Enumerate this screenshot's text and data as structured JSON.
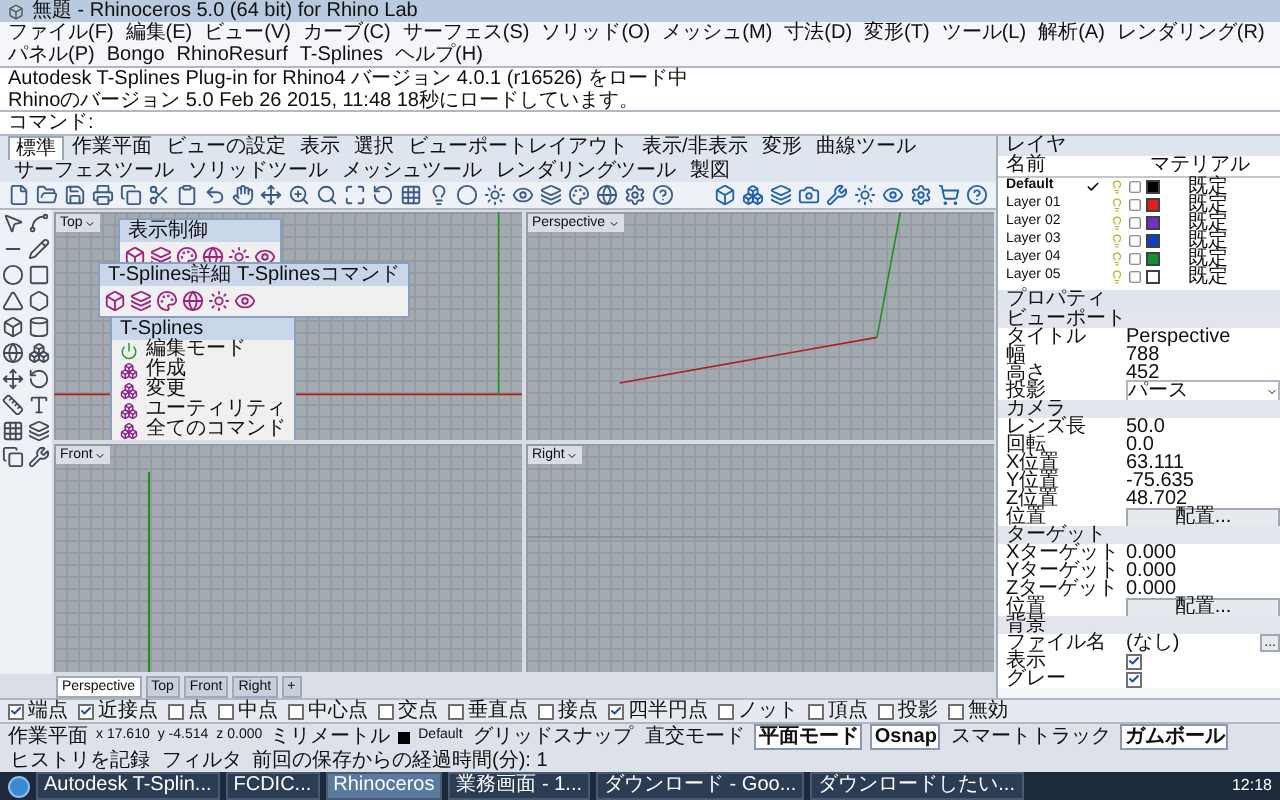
{
  "window": {
    "title": "無題 - Rhinoceros 5.0 (64 bit) for Rhino Lab"
  },
  "menu": [
    "ファイル(F)",
    "編集(E)",
    "ビュー(V)",
    "カーブ(C)",
    "サーフェス(S)",
    "ソリッド(O)",
    "メッシュ(M)",
    "寸法(D)",
    "変形(T)",
    "ツール(L)",
    "解析(A)",
    "レンダリング(R)",
    "パネル(P)",
    "Bongo",
    "RhinoResurf",
    "T-Splines",
    "ヘルプ(H)"
  ],
  "history": [
    "Autodesk T-Splines Plug-in for Rhino4 バージョン 4.0.1 (r16526) をロード中",
    "Rhinoのバージョン 5.0 Feb 26 2015, 11:48 18秒にロードしています。"
  ],
  "command": {
    "prompt": "コマンド:"
  },
  "toolbar_tabs": [
    {
      "label": "標準",
      "selected": true
    },
    {
      "label": "作業平面",
      "selected": false
    },
    {
      "label": "ビューの設定",
      "selected": false
    },
    {
      "label": "表示",
      "selected": false
    },
    {
      "label": "選択",
      "selected": false
    },
    {
      "label": "ビューポートレイアウト",
      "selected": false
    },
    {
      "label": "表示/非表示",
      "selected": false
    },
    {
      "label": "変形",
      "selected": false
    },
    {
      "label": "曲線ツール",
      "selected": false
    },
    {
      "label": "サーフェスツール",
      "selected": false
    },
    {
      "label": "ソリッドツール",
      "selected": false
    },
    {
      "label": "メッシュツール",
      "selected": false
    },
    {
      "label": "レンダリングツール",
      "selected": false
    },
    {
      "label": "製図",
      "selected": false
    }
  ],
  "viewports": [
    {
      "title": "Top",
      "kind": "top"
    },
    {
      "title": "Perspective",
      "kind": "perspective"
    },
    {
      "title": "Front",
      "kind": "front"
    },
    {
      "title": "Right",
      "kind": "right"
    }
  ],
  "floating_panels": [
    {
      "title": "表示制御",
      "kind": "icons"
    },
    {
      "title": "T-Splines詳細 T-Splinesコマンド",
      "kind": "icons"
    },
    {
      "title": "T-Splines",
      "kind": "menu",
      "items": [
        "編集モード",
        "作成",
        "変更",
        "ユーティリティ",
        "全てのコマンド"
      ]
    }
  ],
  "viewport_tabs": [
    {
      "label": "Perspective",
      "selected": true
    },
    {
      "label": "Top",
      "selected": false
    },
    {
      "label": "Front",
      "selected": false
    },
    {
      "label": "Right",
      "selected": false
    }
  ],
  "add_tab": "+",
  "osnaps": [
    {
      "label": "端点",
      "checked": true
    },
    {
      "label": "近接点",
      "checked": true
    },
    {
      "label": "点",
      "checked": false
    },
    {
      "label": "中点",
      "checked": false
    },
    {
      "label": "中心点",
      "checked": false
    },
    {
      "label": "交点",
      "checked": false
    },
    {
      "label": "垂直点",
      "checked": false
    },
    {
      "label": "接点",
      "checked": false
    },
    {
      "label": "四半円点",
      "checked": true
    },
    {
      "label": "ノット",
      "checked": false
    },
    {
      "label": "頂点",
      "checked": false
    },
    {
      "label": "投影",
      "checked": false
    },
    {
      "label": "無効",
      "checked": false
    }
  ],
  "status_bar": {
    "cplane": "作業平面",
    "x": "x 17.610",
    "y": "y -4.514",
    "z": "z 0.000",
    "units": "ミリメートル",
    "layer": "Default",
    "toggles": [
      {
        "label": "グリッドスナップ",
        "on": false
      },
      {
        "label": "直交モード",
        "on": false
      },
      {
        "label": "平面モード",
        "on": true
      },
      {
        "label": "Osnap",
        "on": true
      },
      {
        "label": "スマートトラック",
        "on": false
      },
      {
        "label": "ガムボール",
        "on": true
      },
      {
        "label": "ヒストリを記録",
        "on": false
      },
      {
        "label": "フィルタ",
        "on": false
      }
    ],
    "message": "前回の保存からの経過時間(分): 1"
  },
  "layers": {
    "title": "レイヤ",
    "columns": [
      "名前",
      "マテリアル"
    ],
    "rows": [
      {
        "name": "Default",
        "current": true,
        "color": "#000000",
        "material": "既定"
      },
      {
        "name": "Layer 01",
        "current": false,
        "color": "#e02020",
        "material": "既定"
      },
      {
        "name": "Layer 02",
        "current": false,
        "color": "#7030c0",
        "material": "既定"
      },
      {
        "name": "Layer 03",
        "current": false,
        "color": "#1040c0",
        "material": "既定"
      },
      {
        "name": "Layer 04",
        "current": false,
        "color": "#109030",
        "material": "既定"
      },
      {
        "name": "Layer 05",
        "current": false,
        "color": "#ffffff",
        "material": "既定"
      }
    ]
  },
  "properties": {
    "title": "プロパティ",
    "sections": [
      {
        "title": "ビューポート",
        "rows": [
          {
            "kind": "text",
            "label": "タイトル",
            "value": "Perspective"
          },
          {
            "kind": "text",
            "label": "幅",
            "value": "788"
          },
          {
            "kind": "text",
            "label": "高さ",
            "value": "452"
          },
          {
            "kind": "dropdown",
            "label": "投影",
            "value": "パース"
          }
        ]
      },
      {
        "title": "カメラ",
        "rows": [
          {
            "kind": "text",
            "label": "レンズ長",
            "value": "50.0"
          },
          {
            "kind": "text",
            "label": "回転",
            "value": "0.0"
          },
          {
            "kind": "text",
            "label": "X位置",
            "value": "63.111"
          },
          {
            "kind": "text",
            "label": "Y位置",
            "value": "-75.635"
          },
          {
            "kind": "text",
            "label": "Z位置",
            "value": "48.702"
          },
          {
            "kind": "button",
            "label": "位置",
            "value": "配置..."
          }
        ]
      },
      {
        "title": "ターゲット",
        "rows": [
          {
            "kind": "text",
            "label": "Xターゲット",
            "value": "0.000"
          },
          {
            "kind": "text",
            "label": "Yターゲット",
            "value": "0.000"
          },
          {
            "kind": "text",
            "label": "Zターゲット",
            "value": "0.000"
          },
          {
            "kind": "button",
            "label": "位置",
            "value": "配置..."
          }
        ]
      },
      {
        "title": "背景",
        "rows": [
          {
            "kind": "file",
            "label": "ファイル名",
            "value": "(なし)",
            "button": "..."
          },
          {
            "kind": "checkbox",
            "label": "表示",
            "checked": true
          },
          {
            "kind": "checkbox",
            "label": "グレー",
            "checked": true
          }
        ]
      }
    ]
  },
  "taskbar": {
    "items": [
      {
        "label": "Autodesk T-Splin...",
        "selected": false
      },
      {
        "label": "FCDIC...",
        "selected": false
      },
      {
        "label": "Rhinoceros",
        "selected": true
      },
      {
        "label": "業務画面 - 1...",
        "selected": false
      },
      {
        "label": "ダウンロード - Goo...",
        "selected": false
      },
      {
        "label": "ダウンロードしたい...",
        "selected": false
      }
    ],
    "clock": "12:18"
  }
}
